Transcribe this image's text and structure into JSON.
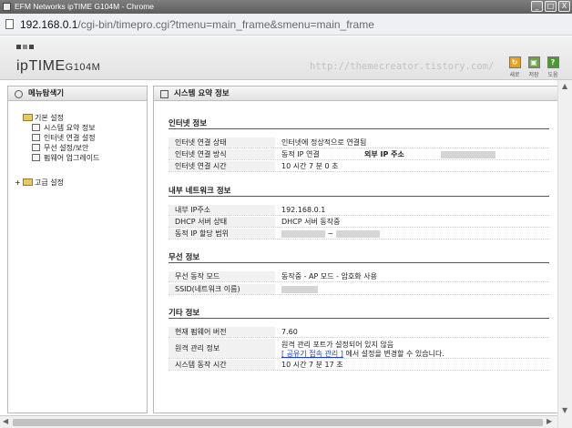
{
  "window": {
    "title": "EFM Networks ipTIME G104M - Chrome",
    "controls": [
      "_",
      "□",
      "X"
    ]
  },
  "address_bar": {
    "url_host": "192.168.0.1",
    "url_path": "/cgi-bin/timepro.cgi?tmenu=main_frame&smenu=main_frame"
  },
  "header": {
    "logo": "ipTIME",
    "model": "G104M",
    "watermark": "http://themecreator.tistory.com/",
    "icons": [
      {
        "name": "refresh",
        "label": "새로",
        "color": "#e8a21b",
        "glyph": "↻"
      },
      {
        "name": "save",
        "label": "저장",
        "color": "#6aa73b",
        "glyph": "▣"
      },
      {
        "name": "help",
        "label": "도움",
        "color": "#4a9a2f",
        "glyph": "?"
      }
    ]
  },
  "left_panel": {
    "title": "메뉴탐색기",
    "basic_group": "기본 설정",
    "basic_items": [
      "시스템 요약 정보",
      "인터넷 연결 설정",
      "무선 설정/보안",
      "펌웨어 업그레이드"
    ],
    "advanced_group": "고급 설정",
    "plus": "+"
  },
  "right_panel": {
    "title": "시스템 요약 정보",
    "internet": {
      "title": "인터넷 정보",
      "rows": [
        {
          "label": "인터넷 연결 상태",
          "value": "인터넷에 정상적으로 연결됨"
        },
        {
          "label": "인터넷 연결 방식",
          "value": "동적 IP 연결",
          "extra_label": "외부 IP 주소"
        },
        {
          "label": "인터넷 연결 시간",
          "value": "10 시간 7 분 0 초"
        }
      ]
    },
    "internal": {
      "title": "내부 네트워크 정보",
      "rows": [
        {
          "label": "내부 IP주소",
          "value": "192.168.0.1"
        },
        {
          "label": "DHCP 서버 상태",
          "value": "DHCP 서버 동작중"
        },
        {
          "label": "동적 IP 할당 범위",
          "value": "~"
        }
      ]
    },
    "wireless": {
      "title": "무선 정보",
      "rows": [
        {
          "label": "무선 동작 모드",
          "value": "동작중 - AP 모드 - 암호화 사용"
        },
        {
          "label": "SSID(네트워크 이름)",
          "value": ""
        }
      ]
    },
    "other": {
      "title": "기타 정보",
      "rows": [
        {
          "label": "현재 펌웨어 버전",
          "value": "7.60"
        },
        {
          "label": "원격 관리 정보",
          "value_line1": "원격 관리 포트가 설정되어 있지 않음",
          "link": "[ 공유기 접속 관리 ]",
          "value_line2_suffix": "에서 설정을 변경할 수 있습니다."
        },
        {
          "label": "시스템 동작 시간",
          "value": "10 시간 7 분 17 초"
        }
      ]
    }
  }
}
